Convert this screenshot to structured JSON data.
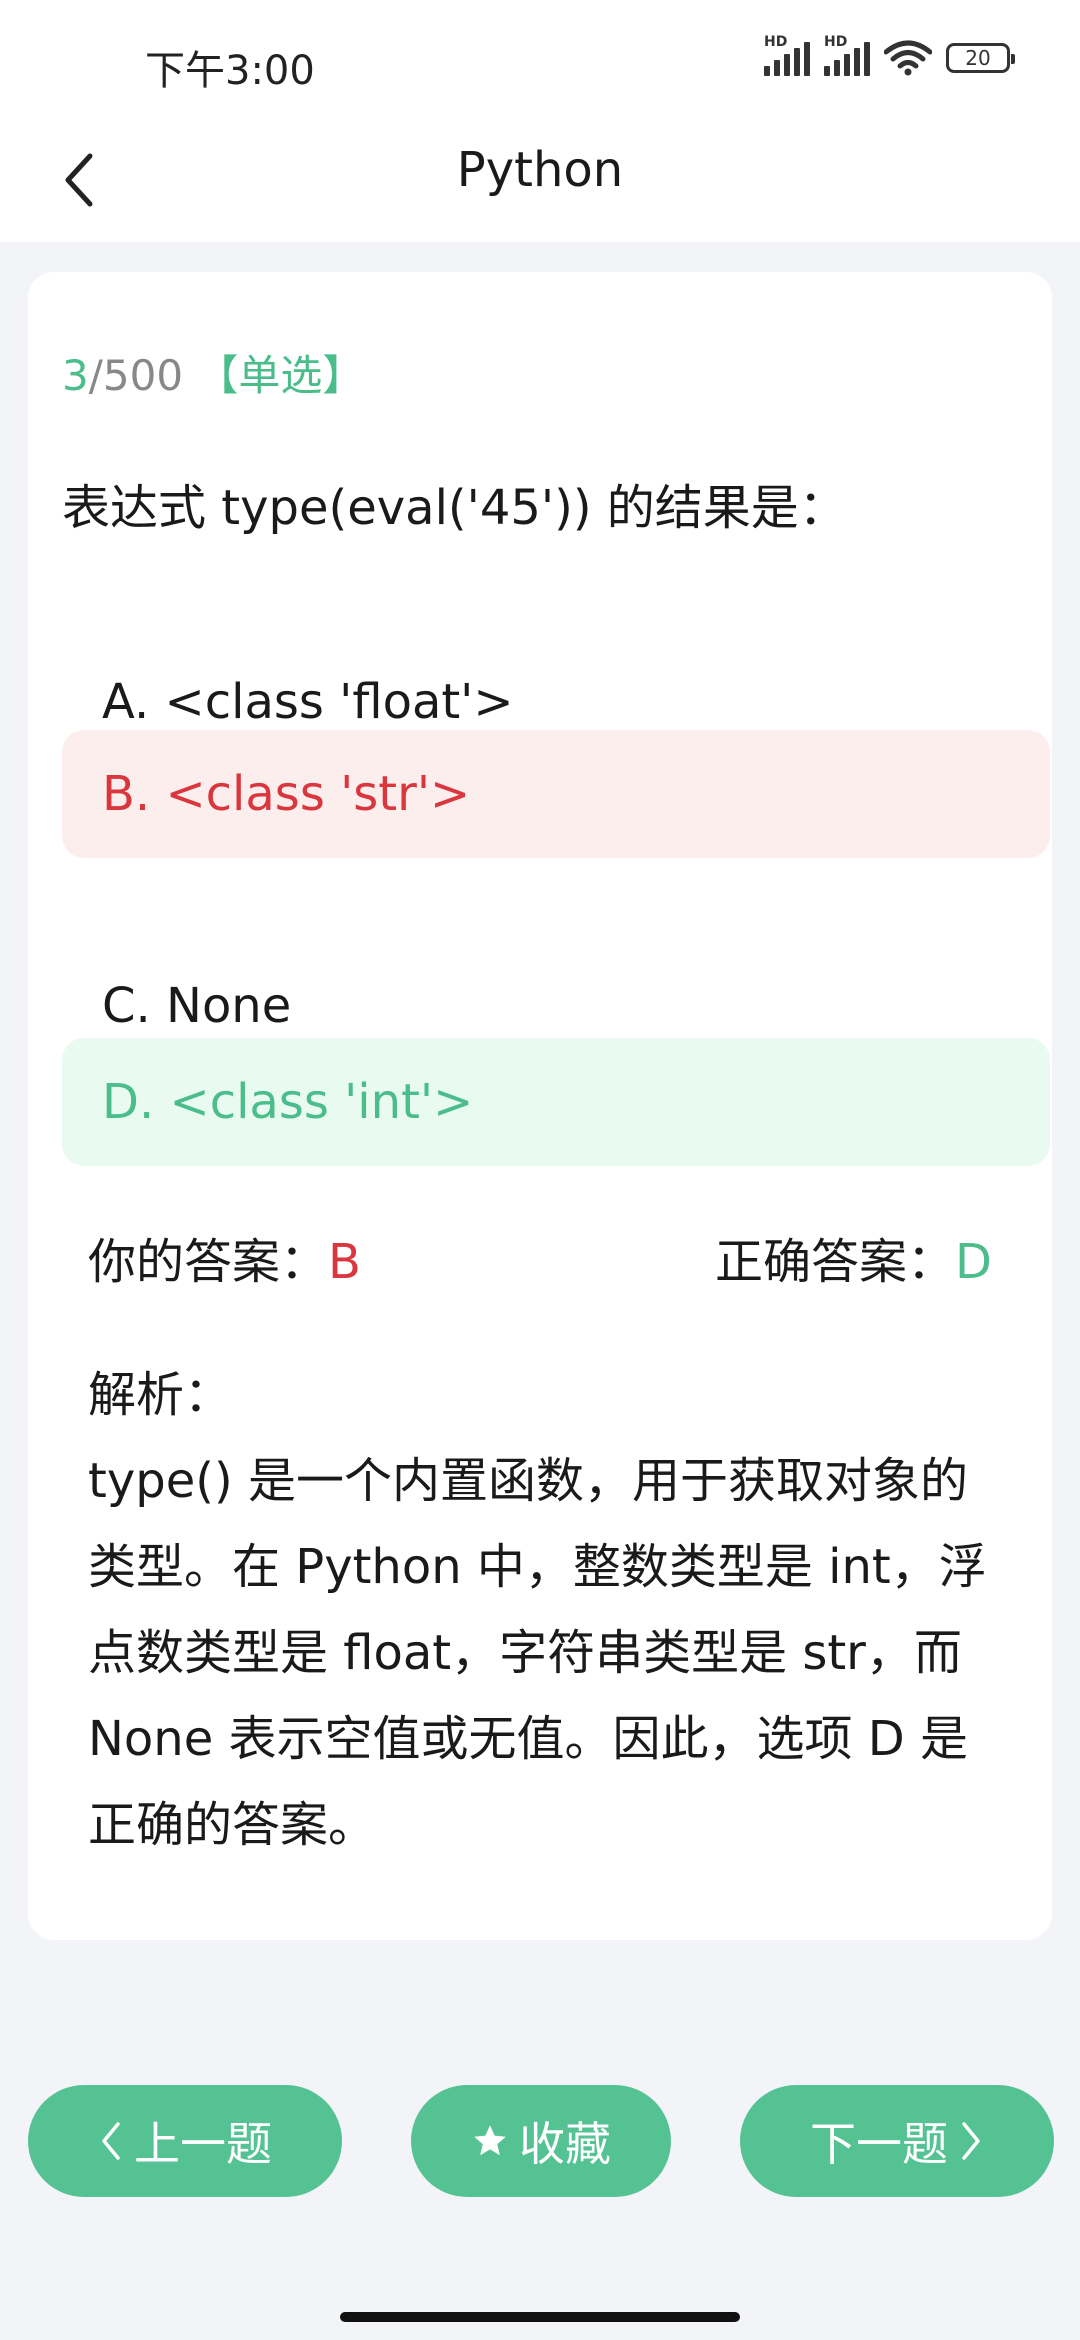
{
  "status": {
    "time": "下午3:00",
    "battery": "20",
    "hd1": "HD",
    "hd2": "HD"
  },
  "nav": {
    "title": "Python",
    "back_icon": "chevron-left-icon"
  },
  "question": {
    "number": "3",
    "total": "/500",
    "type": "【单选】",
    "text": "表达式 type(eval('45')) 的结果是："
  },
  "options": [
    {
      "label": "A. <class 'float'>",
      "state": "normal"
    },
    {
      "label": "B. <class 'str'>",
      "state": "wrong"
    },
    {
      "label": "C. None",
      "state": "normal"
    },
    {
      "label": "D. <class 'int'>",
      "state": "correct"
    }
  ],
  "answers": {
    "yours_label": "你的答案：",
    "yours_value": "B",
    "correct_label": "正确答案：",
    "correct_value": "D"
  },
  "analysis": {
    "heading": "解析：",
    "body": "type() 是一个内置函数，用于获取对象的类型。在 Python 中，整数类型是 int，浮点数类型是 float，字符串类型是 str，而 None 表示空值或无值。因此，选项 D 是正确的答案。"
  },
  "buttons": {
    "prev": "上一题",
    "favorite": "收藏",
    "next": "下一题"
  },
  "colors": {
    "accent": "#55c293",
    "correct": "#4bbd8b",
    "wrong": "#d9363e",
    "wrong_bg": "#fdeeee",
    "correct_bg": "#e9fbf1"
  }
}
